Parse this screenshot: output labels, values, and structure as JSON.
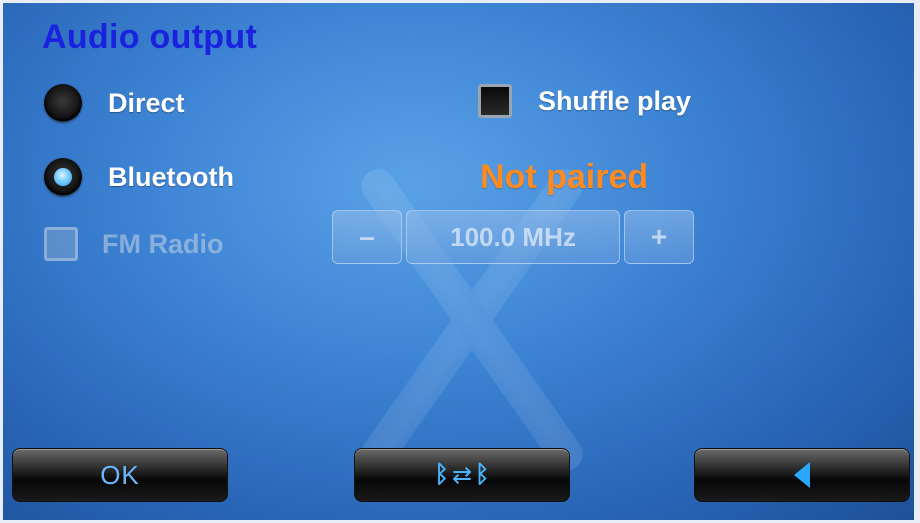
{
  "title": "Audio output",
  "options": {
    "direct": {
      "label": "Direct",
      "selected": false
    },
    "bluetooth": {
      "label": "Bluetooth",
      "selected": true
    },
    "fm_radio": {
      "label": "FM Radio",
      "enabled": false
    }
  },
  "shuffle": {
    "label": "Shuffle play",
    "checked": false
  },
  "status": {
    "text": "Not paired",
    "color": "#ff8a1f"
  },
  "tuner": {
    "minus": "–",
    "frequency": "100.0 MHz",
    "plus": "+"
  },
  "buttons": {
    "ok": "OK",
    "bt_pair": {
      "left_icon": "ᛒ",
      "arrows": "⇄",
      "right_icon": "ᛒ"
    },
    "back_icon": "back-triangle-icon"
  },
  "colors": {
    "title": "#1a22e0",
    "accent": "#49b3ff"
  }
}
